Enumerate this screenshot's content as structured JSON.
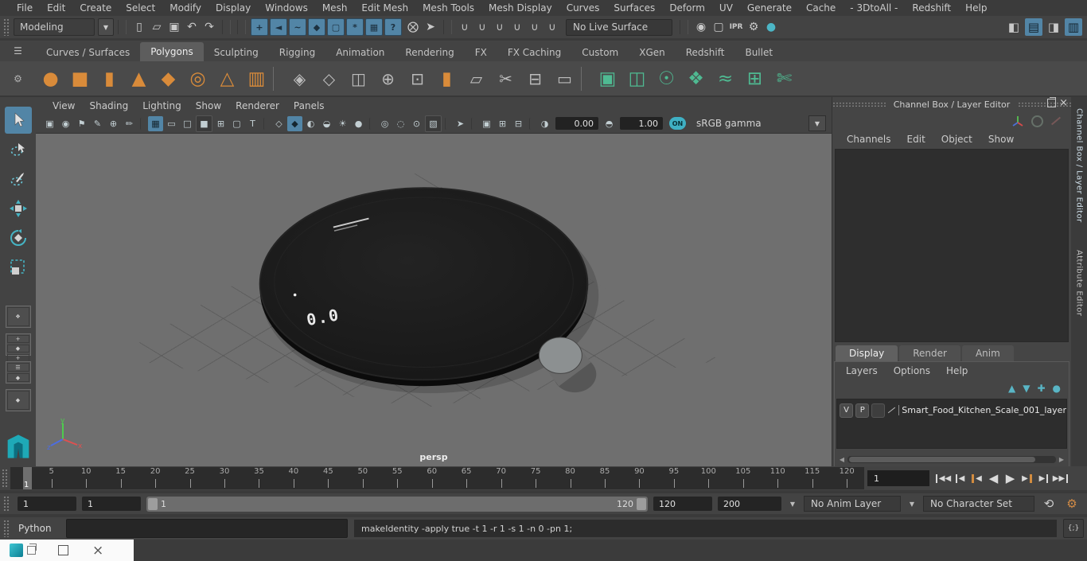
{
  "menubar": {
    "items": [
      "File",
      "Edit",
      "Create",
      "Select",
      "Modify",
      "Display",
      "Windows",
      "Mesh",
      "Edit Mesh",
      "Mesh Tools",
      "Mesh Display",
      "Curves",
      "Surfaces",
      "Deform",
      "UV",
      "Generate",
      "Cache",
      "- 3DtoAll -",
      "Redshift",
      "Help"
    ]
  },
  "toolbar": {
    "mode": "Modeling",
    "live_surface": "No Live Surface",
    "file_icons": [
      {
        "name": "new-scene-icon",
        "glyph": "▯"
      },
      {
        "name": "open-scene-icon",
        "glyph": "▱"
      },
      {
        "name": "save-scene-icon",
        "glyph": "▣"
      },
      {
        "name": "undo-icon",
        "glyph": "↶"
      },
      {
        "name": "redo-icon",
        "glyph": "↷"
      }
    ],
    "mask_icons": [
      {
        "name": "selection-mask-all-icon",
        "glyph": "+"
      },
      {
        "name": "selection-mask-handles-icon",
        "glyph": "◄"
      },
      {
        "name": "selection-mask-curves-icon",
        "glyph": "~"
      },
      {
        "name": "selection-mask-surfaces-icon",
        "glyph": "◆"
      },
      {
        "name": "selection-mask-deformations-icon",
        "glyph": "▢"
      },
      {
        "name": "selection-mask-dynamics-icon",
        "glyph": "*"
      },
      {
        "name": "selection-mask-rendering-icon",
        "glyph": "▦"
      },
      {
        "name": "selection-mask-misc-icon",
        "glyph": "?"
      }
    ],
    "lock_icons": [
      {
        "name": "lock-selection-icon",
        "glyph": "⨂"
      },
      {
        "name": "highlight-selection-icon",
        "glyph": "➤"
      }
    ],
    "snap_icons": [
      {
        "name": "snap-to-grids-icon",
        "glyph": "∪"
      },
      {
        "name": "snap-to-curves-icon",
        "glyph": "∪"
      },
      {
        "name": "snap-to-points-icon",
        "glyph": "∪"
      },
      {
        "name": "snap-to-projected-center-icon",
        "glyph": "∪"
      },
      {
        "name": "snap-to-view-planes-icon",
        "glyph": "∪"
      },
      {
        "name": "make-object-live-icon",
        "glyph": "∪"
      }
    ],
    "render_icons": [
      {
        "name": "open-render-view-icon",
        "glyph": "◉"
      },
      {
        "name": "render-current-frame-icon",
        "glyph": "▢"
      },
      {
        "name": "ipr-render-icon",
        "glyph": "IPR",
        "cls": "iprbtn"
      },
      {
        "name": "render-settings-icon",
        "glyph": "⚙"
      },
      {
        "name": "render-sphere-icon",
        "glyph": "●",
        "cls": "teal"
      }
    ],
    "dock_icons": [
      {
        "name": "modeling-toolkit-icon",
        "glyph": "◧"
      },
      {
        "name": "attribute-editor-icon",
        "glyph": "▤",
        "cls": "activedock"
      },
      {
        "name": "tool-settings-icon",
        "glyph": "◨"
      },
      {
        "name": "channel-box-icon",
        "glyph": "▥",
        "cls": "activedock"
      }
    ]
  },
  "shelf": {
    "tabs": [
      {
        "label": "Curves / Surfaces"
      },
      {
        "label": "Polygons",
        "cls": "active"
      },
      {
        "label": "Sculpting"
      },
      {
        "label": "Rigging"
      },
      {
        "label": "Animation"
      },
      {
        "label": "Rendering"
      },
      {
        "label": "FX"
      },
      {
        "label": "FX Caching"
      },
      {
        "label": "Custom"
      },
      {
        "label": "XGen"
      },
      {
        "label": "Redshift"
      },
      {
        "label": "Bullet"
      }
    ],
    "icons": [
      {
        "name": "poly-sphere-icon",
        "glyph": "●",
        "cls": "orange"
      },
      {
        "name": "poly-cube-icon",
        "glyph": "■",
        "cls": "orange"
      },
      {
        "name": "poly-cylinder-icon",
        "glyph": "▮",
        "cls": "orange"
      },
      {
        "name": "poly-cone-icon",
        "glyph": "▲",
        "cls": "orange"
      },
      {
        "name": "poly-plane-icon",
        "glyph": "◆",
        "cls": "orange"
      },
      {
        "name": "poly-torus-icon",
        "glyph": "◎",
        "cls": "orange"
      },
      {
        "name": "poly-pyramid-icon",
        "glyph": "△",
        "cls": "orange"
      },
      {
        "name": "poly-pipe-icon",
        "glyph": "▥",
        "cls": "orange"
      },
      {
        "name": "shelf-separator",
        "glyph": "",
        "cls": "ssep"
      },
      {
        "name": "combine-icon",
        "glyph": "◈",
        "cls": "gray"
      },
      {
        "name": "separate-icon",
        "glyph": "◇",
        "cls": "gray"
      },
      {
        "name": "mirror-icon",
        "glyph": "◫",
        "cls": "gray"
      },
      {
        "name": "merge-vertices-icon",
        "glyph": "⊕",
        "cls": "gray"
      },
      {
        "name": "smooth-icon",
        "glyph": "⊡",
        "cls": "gray"
      },
      {
        "name": "extrude-icon",
        "glyph": "▮",
        "cls": "orange"
      },
      {
        "name": "bevel-icon",
        "glyph": "▱",
        "cls": "gray"
      },
      {
        "name": "multi-cut-icon",
        "glyph": "✂",
        "cls": "gray"
      },
      {
        "name": "edge-flow-icon",
        "glyph": "⊟",
        "cls": "gray"
      },
      {
        "name": "quad-draw-icon",
        "glyph": "▭",
        "cls": "gray"
      },
      {
        "name": "shelf-separator",
        "glyph": "",
        "cls": "ssep"
      },
      {
        "name": "planar-mapping-icon",
        "glyph": "▣",
        "cls": "green"
      },
      {
        "name": "cylindrical-mapping-icon",
        "glyph": "◫",
        "cls": "green"
      },
      {
        "name": "spherical-mapping-icon",
        "glyph": "☉",
        "cls": "green"
      },
      {
        "name": "automatic-mapping-icon",
        "glyph": "❖",
        "cls": "green"
      },
      {
        "name": "unfold-uv-icon",
        "glyph": "≈",
        "cls": "green"
      },
      {
        "name": "uv-editor-icon",
        "glyph": "⊞",
        "cls": "green"
      },
      {
        "name": "cut-uv-edges-icon",
        "glyph": "✄",
        "cls": "green"
      }
    ]
  },
  "panel_menus": [
    "View",
    "Shading",
    "Lighting",
    "Show",
    "Renderer",
    "Panels"
  ],
  "vp_icons": [
    {
      "name": "select-camera-icon",
      "glyph": "▣"
    },
    {
      "name": "camera-attributes-icon",
      "glyph": "◉"
    },
    {
      "name": "bookmarks-icon",
      "glyph": "⚑"
    },
    {
      "name": "image-plane-icon",
      "glyph": "✎"
    },
    {
      "name": "two-d-pan-zoom-icon",
      "glyph": "⊕"
    },
    {
      "name": "grease-pencil-icon",
      "glyph": "✏"
    },
    {
      "name": "separator",
      "glyph": "",
      "cls": "vpsep"
    },
    {
      "name": "grid-icon",
      "glyph": "▦",
      "cls": "active"
    },
    {
      "name": "film-gate-icon",
      "glyph": "▭"
    },
    {
      "name": "resolution-gate-icon",
      "glyph": "□"
    },
    {
      "name": "gate-mask-icon",
      "glyph": "■",
      "cls": "dark"
    },
    {
      "name": "field-chart-icon",
      "glyph": "⊞"
    },
    {
      "name": "safe-action-icon",
      "glyph": "▢"
    },
    {
      "name": "safe-title-icon",
      "glyph": "T"
    },
    {
      "name": "separator",
      "glyph": "",
      "cls": "vpsep"
    },
    {
      "name": "wireframe-icon",
      "glyph": "◇"
    },
    {
      "name": "smooth-shade-icon",
      "glyph": "◆",
      "cls": "active"
    },
    {
      "name": "textured-icon",
      "glyph": "◐"
    },
    {
      "name": "use-default-material-icon",
      "glyph": "◒"
    },
    {
      "name": "lighting-icon",
      "glyph": "☀"
    },
    {
      "name": "shadows-icon",
      "glyph": "●"
    },
    {
      "name": "separator",
      "glyph": "",
      "cls": "vpsep"
    },
    {
      "name": "screen-space-ao-icon",
      "glyph": "◎"
    },
    {
      "name": "motion-blur-icon",
      "glyph": "◌"
    },
    {
      "name": "multisample-icon",
      "glyph": "⊙"
    },
    {
      "name": "xray-icon",
      "glyph": "▧",
      "cls": "dark"
    },
    {
      "name": "separator",
      "glyph": "",
      "cls": "vpsep"
    },
    {
      "name": "select-highlight-icon",
      "glyph": "➤"
    },
    {
      "name": "separator",
      "glyph": "",
      "cls": "vpsep"
    },
    {
      "name": "isolate-select-icon",
      "glyph": "▣"
    },
    {
      "name": "isolate-add-icon",
      "glyph": "⊞"
    },
    {
      "name": "isolate-remove-icon",
      "glyph": "⊟"
    },
    {
      "name": "separator",
      "glyph": "",
      "cls": "vpsep"
    },
    {
      "name": "exposure-icon",
      "glyph": "◑"
    }
  ],
  "viewport": {
    "exposure": "0.00",
    "gamma": "1.00",
    "on": "ON",
    "colorspace": "sRGB gamma",
    "camera_label": "persp",
    "scale_display": "0.0",
    "axis_x": "x",
    "axis_y": "y",
    "axis_z": "z"
  },
  "channel_box": {
    "title": "Channel Box / Layer Editor",
    "menus": [
      "Channels",
      "Edit",
      "Object",
      "Show"
    ]
  },
  "layer_editor": {
    "tabs": [
      {
        "label": "Display",
        "cls": "active"
      },
      {
        "label": "Render"
      },
      {
        "label": "Anim"
      }
    ],
    "menus": [
      "Layers",
      "Options",
      "Help"
    ],
    "icons": [
      {
        "name": "move-layer-up-icon",
        "glyph": "▲"
      },
      {
        "name": "move-layer-down-icon",
        "glyph": "▼"
      },
      {
        "name": "create-empty-layer-icon",
        "glyph": "✚"
      },
      {
        "name": "create-layer-from-selected-icon",
        "glyph": "●"
      }
    ],
    "layer": {
      "visible": "V",
      "playback": "P",
      "name": "Smart_Food_Kitchen_Scale_001_layer"
    }
  },
  "side_tabs": [
    {
      "label": "Channel Box / Layer Editor",
      "cls": "active"
    },
    {
      "label": "Attribute Editor"
    }
  ],
  "timeline": {
    "current_frame": "1",
    "current_time": "1",
    "ticks": [
      "5",
      "10",
      "15",
      "20",
      "25",
      "30",
      "35",
      "40",
      "45",
      "50",
      "55",
      "60",
      "65",
      "70",
      "75",
      "80",
      "85",
      "90",
      "95",
      "100",
      "105",
      "110",
      "115",
      "120"
    ],
    "playback": [
      {
        "name": "go-to-start-button",
        "glyph": "◀◀",
        "cls": "bar-wleft"
      },
      {
        "name": "step-back-frame-button",
        "glyph": "◀",
        "cls": "bar-wleft"
      },
      {
        "name": "step-back-key-button",
        "glyph": "◀",
        "cls": "bar-oleft"
      },
      {
        "name": "play-backwards-button",
        "glyph": "◀",
        "cls": "big"
      },
      {
        "name": "play-forwards-button",
        "glyph": "▶",
        "cls": "big"
      },
      {
        "name": "step-forward-key-button",
        "glyph": "▶",
        "cls": "bar-oright"
      },
      {
        "name": "step-forward-frame-button",
        "glyph": "▶",
        "cls": "bar-wright"
      },
      {
        "name": "go-to-end-button",
        "glyph": "▶▶",
        "cls": "bar-wright"
      }
    ]
  },
  "range": {
    "anim_start": "1",
    "playback_start": "1",
    "bar_start": "1",
    "bar_end": "120",
    "playback_end": "120",
    "anim_end": "200",
    "anim_layer": "No Anim Layer",
    "character_set": "No Character Set"
  },
  "command": {
    "label": "Python",
    "input_value": "",
    "result": "makeIdentity -apply true -t 1 -r 1 -s 1 -n 0 -pn 1;",
    "script_editor_glyph": "{;}"
  }
}
